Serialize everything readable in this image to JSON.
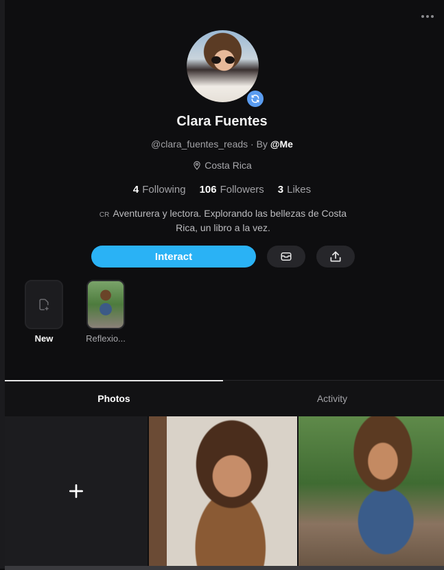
{
  "profile": {
    "name": "Clara Fuentes",
    "handle": "@clara_fuentes_reads",
    "by_separator": "· By",
    "by_user": "@Me",
    "location": "Costa Rica",
    "bio_flag": "CR",
    "bio": "Aventurera y lectora. Explorando las bellezas de Costa Rica, un libro a la vez."
  },
  "stats": {
    "following_count": "4",
    "following_label": "Following",
    "followers_count": "106",
    "followers_label": "Followers",
    "likes_count": "3",
    "likes_label": "Likes"
  },
  "actions": {
    "interact_label": "Interact"
  },
  "stories": [
    {
      "label": "New"
    },
    {
      "label": "Reflexio..."
    }
  ],
  "tabs": [
    {
      "label": "Photos",
      "active": true
    },
    {
      "label": "Activity",
      "active": false
    }
  ],
  "colors": {
    "accent": "#2ab2f5",
    "background": "#0e0e10",
    "badge": "#5a9cf0"
  }
}
